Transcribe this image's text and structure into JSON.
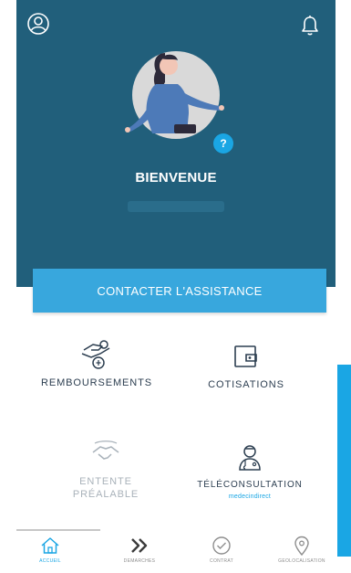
{
  "header": {
    "welcome_title": "BIENVENUE"
  },
  "assistance_button": "CONTACTER L'ASSISTANCE",
  "avatar_help_badge": "?",
  "tiles": {
    "remboursements": "REMBOURSEMENTS",
    "cotisations": "COTISATIONS",
    "entente": "ENTENTE\nPRÉALABLE",
    "teleconsultation": "TÉLÉCONSULTATION",
    "teleconsultation_brand": "medecindirect"
  },
  "nav": {
    "home": "ACCUEIL",
    "demarches": "DEMARCHES",
    "contrat": "CONTRAT",
    "geolocalisation": "GEOLOCALISATION"
  },
  "colors": {
    "header_bg": "#215f7b",
    "accent": "#1aa6e4",
    "button_bg": "#38a7dd"
  }
}
